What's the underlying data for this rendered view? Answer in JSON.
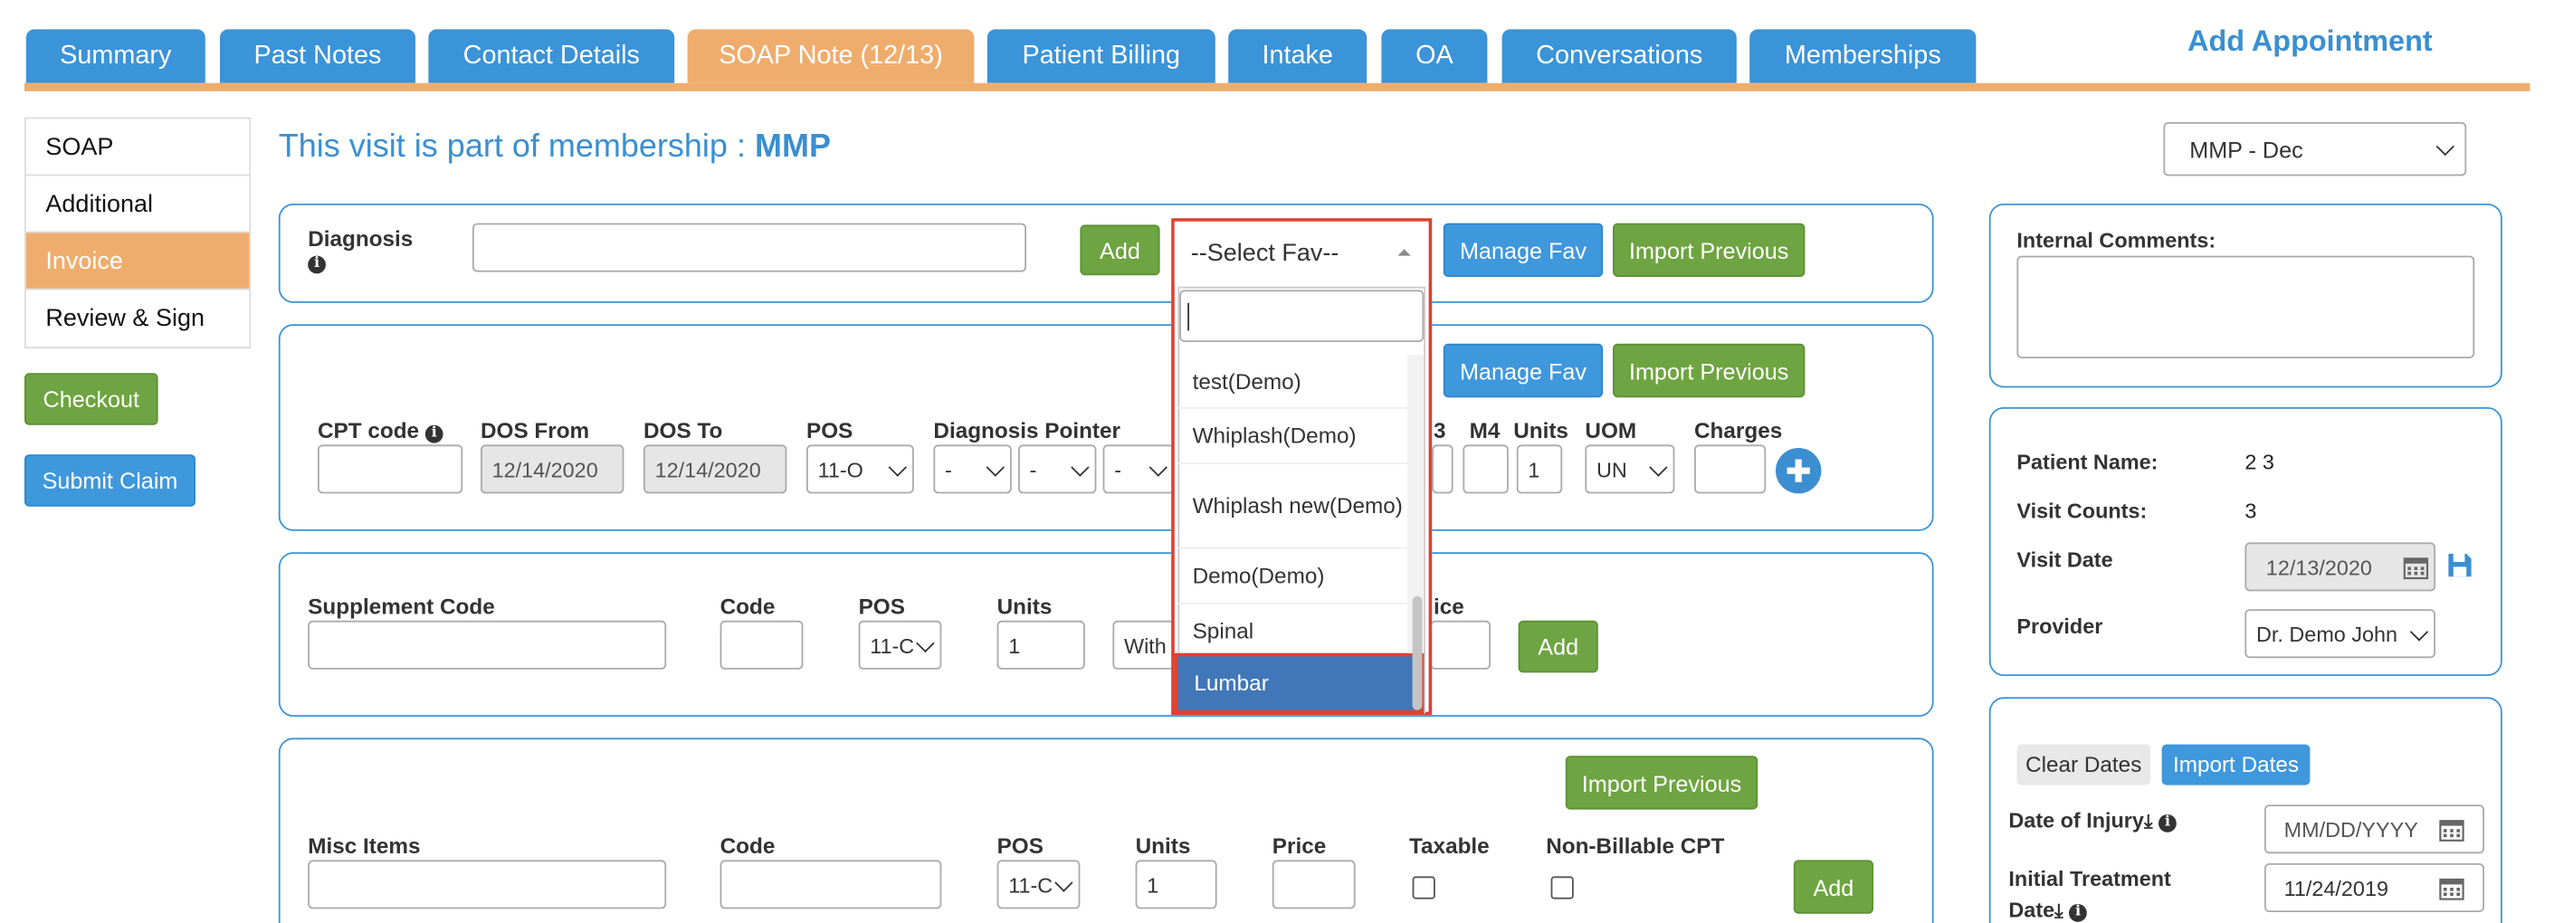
{
  "tabs": [
    {
      "label": "Summary",
      "active": false
    },
    {
      "label": "Past Notes",
      "active": false
    },
    {
      "label": "Contact Details",
      "active": false
    },
    {
      "label": "SOAP Note (12/13)",
      "active": true
    },
    {
      "label": "Patient Billing",
      "active": false
    },
    {
      "label": "Intake",
      "active": false
    },
    {
      "label": "OA",
      "active": false
    },
    {
      "label": "Conversations",
      "active": false
    },
    {
      "label": "Memberships",
      "active": false
    }
  ],
  "add_appointment": "Add Appointment",
  "side_menu": [
    "SOAP",
    "Additional",
    "Invoice",
    "Review & Sign"
  ],
  "side_menu_active": "Invoice",
  "checkout_label": "Checkout",
  "submit_claim_label": "Submit Claim",
  "membership_prefix": "This visit is part of membership :",
  "membership_name": "MMP",
  "membership_select": "MMP - Dec",
  "diagnosis": {
    "label": "Diagnosis",
    "value": "",
    "add_label": "Add",
    "select_fav": "--Select Fav--",
    "search_value": "",
    "manage_fav": "Manage Fav",
    "import_previous": "Import Previous",
    "fav_options": [
      "test(Demo)",
      "Whiplash(Demo)",
      "Whiplash new(Demo)",
      "Demo(Demo)",
      "Spinal",
      "Lumbar"
    ],
    "highlighted_option": "Lumbar"
  },
  "cpt": {
    "manage_fav": "Manage Fav",
    "import_previous": "Import Previous",
    "headers": {
      "cpt_code": "CPT code",
      "dos_from": "DOS From",
      "dos_to": "DOS To",
      "pos": "POS",
      "diagnosis_pointer": "Diagnosis Pointer",
      "m3": "3",
      "m4": "M4",
      "units": "Units",
      "uom": "UOM",
      "charges": "Charges"
    },
    "cpt_code": "",
    "dos_from": "12/14/2020",
    "dos_to": "12/14/2020",
    "pos": "11-O",
    "pointers": [
      "-",
      "-",
      "-"
    ],
    "units": "1",
    "uom": "UN",
    "charges": ""
  },
  "supplement": {
    "headers": {
      "code_label": "Supplement Code",
      "code": "Code",
      "pos": "POS",
      "units": "Units",
      "price_partial": "ice"
    },
    "pos": "11-C",
    "units": "1",
    "with_partial": "With",
    "add_label": "Add"
  },
  "misc": {
    "import_previous": "Import Previous",
    "headers": {
      "items": "Misc Items",
      "code": "Code",
      "pos": "POS",
      "units": "Units",
      "price": "Price",
      "taxable": "Taxable",
      "non_billable": "Non-Billable CPT"
    },
    "pos": "11-C",
    "units": "1",
    "add_label": "Add"
  },
  "internal_comments_label": "Internal Comments:",
  "patient": {
    "name_label": "Patient Name:",
    "name": "2 3",
    "visits_label": "Visit Counts:",
    "visits": "3",
    "visit_date_label": "Visit Date",
    "visit_date": "12/13/2020",
    "provider_label": "Provider",
    "provider": "Dr. Demo John"
  },
  "dates": {
    "clear_label": "Clear Dates",
    "import_label": "Import Dates",
    "injury_label": "Date of Injury",
    "injury_placeholder": "MM/DD/YYYY",
    "initial_label_1": "Initial Treatment",
    "initial_label_2": "Date",
    "initial_value": "11/24/2019"
  },
  "colors": {
    "tab_blue": "#3b93d8",
    "tab_active": "#efad6d",
    "green": "#6ea441",
    "highlight_red": "#e0402d",
    "selected_blue": "#4177b8"
  }
}
